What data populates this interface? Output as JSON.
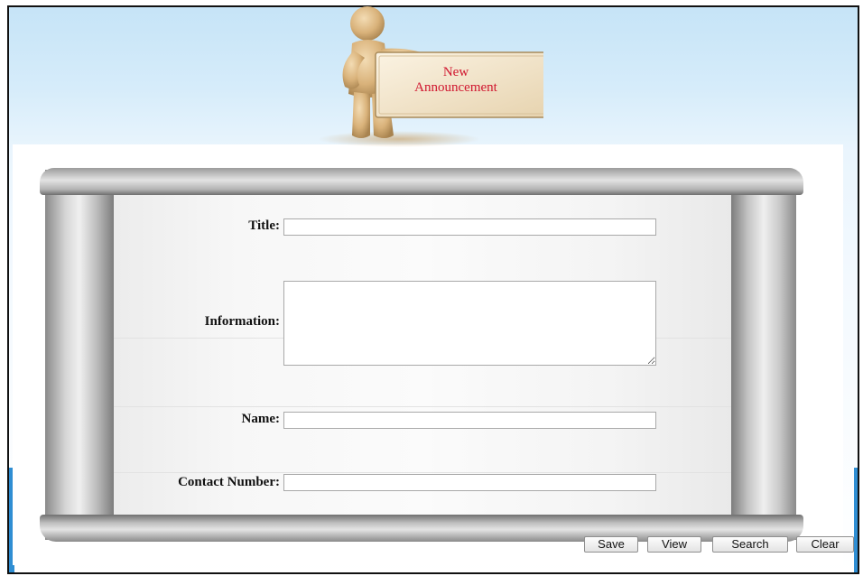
{
  "banner": {
    "sign_line1": "New",
    "sign_line2": "Announcement"
  },
  "form": {
    "title_label": "Title:",
    "title_value": "",
    "information_label": "Information:",
    "information_value": "",
    "name_label": "Name:",
    "name_value": "",
    "contact_label": "Contact Number:",
    "contact_value": ""
  },
  "buttons": {
    "save": "Save",
    "view": "View",
    "search": "Search",
    "clear": "Clear"
  },
  "colors": {
    "sign_text": "#d0162f",
    "accent_strip": "#2f8ed3",
    "header_gradient_top": "#c6e4f7"
  }
}
